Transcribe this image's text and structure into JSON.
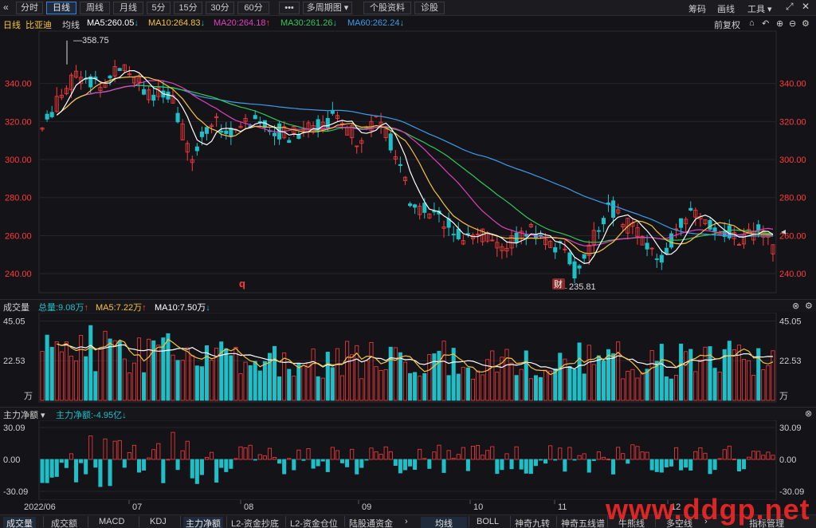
{
  "toolbar": {
    "back_icon": "«",
    "tabs": [
      "分时",
      "日线",
      "周线",
      "月线",
      "5分",
      "15分",
      "30分",
      "60分",
      "•••",
      "多周期图 ▾",
      "个股资料",
      "诊股"
    ],
    "active_tab": "日线",
    "right": [
      "筹码",
      "画线",
      "工具 ▾"
    ]
  },
  "stock": {
    "period": "日线",
    "name": "比亚迪",
    "ma_type": "均线",
    "adjust": "前复权",
    "ma": [
      {
        "label": "MA5:260.05",
        "arrow": "↓",
        "color": "#ffffff"
      },
      {
        "label": "MA10:264.83",
        "arrow": "↓",
        "color": "#f5c242"
      },
      {
        "label": "MA20:264.18",
        "arrow": "↑",
        "color": "#e23fbf"
      },
      {
        "label": "MA30:261.26",
        "arrow": "↓",
        "color": "#32c75a"
      },
      {
        "label": "MA60:262.24",
        "arrow": "↓",
        "color": "#3c9ce8"
      }
    ]
  },
  "price_axis": {
    "labels": [
      "340.00",
      "320.00",
      "300.00",
      "280.00",
      "260.00",
      "240.00"
    ],
    "values": [
      340,
      320,
      300,
      280,
      260,
      240
    ],
    "min": 230,
    "max": 365
  },
  "annotations": {
    "high": "358.75",
    "low": "235.81",
    "finance_badge": "财",
    "marker": "q"
  },
  "volume": {
    "title": "成交量",
    "total": "总量:9.08万",
    "total_arrow": "↑",
    "ma5": "MA5:7.22万",
    "ma5_arrow": "↑",
    "ma10": "MA10:7.50万",
    "ma10_arrow": "↓",
    "axis": [
      "45.05",
      "22.53",
      "万"
    ],
    "values": [
      45.05,
      22.53
    ],
    "max": 48
  },
  "flow": {
    "title": "主力净额 ▾",
    "value": "主力净额:-4.95亿",
    "value_arrow": "↓",
    "axis": [
      "30.09",
      "0.00",
      "-30.09"
    ],
    "values": [
      30.09,
      0,
      -30.09
    ]
  },
  "dates": [
    "2022/06",
    "07",
    "08",
    "09",
    "10",
    "11",
    "12"
  ],
  "bottom_tabs": [
    "成交量",
    "成交额",
    "MACD",
    "KDJ",
    "主力净额",
    "L2-资金抄底",
    "L2-资金仓位",
    "陆股通资金"
  ],
  "bottom_right": [
    "均线",
    "BOLL",
    "神奇九转",
    "神奇五线谱",
    "牛熊线",
    "多空线"
  ],
  "bottom_end": "指标管理",
  "watermark": "www.ddgp.net",
  "colors": {
    "up": "#ff3b3b",
    "down": "#1fbfc7",
    "bg": "#141418",
    "ma5": "#ffffff",
    "ma10": "#f5c242",
    "ma20": "#e23fbf",
    "ma30": "#32c75a",
    "ma60": "#3c9ce8"
  }
}
